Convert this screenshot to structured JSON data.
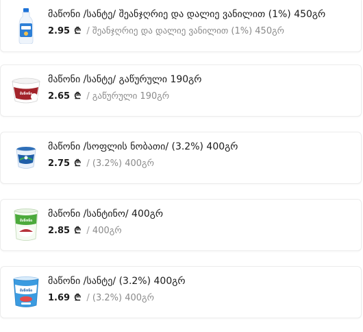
{
  "products": [
    {
      "title": "მაწონი /სანტე/ შეანჯღრიე და დალიე ვანილით (1%) 450გრ",
      "price": "2.95",
      "currency": "₾",
      "separator": "/",
      "subtitle": "შეანჯღრიე და დალიე ვანილით (1%) 450გრ",
      "icon": "drink-bottle-icon"
    },
    {
      "title": "მაწონი /სანტე/ გაწურული 190გრ",
      "price": "2.65",
      "currency": "₾",
      "separator": "/",
      "subtitle": "გაწურული 190გრ",
      "icon": "yogurt-cup-icon",
      "label_text": "მაწონი"
    },
    {
      "title": "მაწონი /სოფლის ნობათი/ (3.2%) 400გრ",
      "price": "2.75",
      "currency": "₾",
      "separator": "/",
      "subtitle": "(3.2%) 400გრ",
      "icon": "yogurt-tub-icon"
    },
    {
      "title": "მაწონი /სანტინო/ 400გრ",
      "price": "2.85",
      "currency": "₾",
      "separator": "/",
      "subtitle": "400გრ",
      "icon": "yogurt-tall-cup-icon",
      "label_text": "მაწონი"
    },
    {
      "title": "მაწონი /სანტე/ (3.2%) 400გრ",
      "price": "1.69",
      "currency": "₾",
      "separator": "/",
      "subtitle": "(3.2%) 400გრ",
      "icon": "yogurt-blue-cup-icon",
      "label_text": "მაწონი"
    }
  ],
  "colors": {
    "border": "#ececec",
    "title": "#1a1a1a",
    "subtitle": "#8a8a8a",
    "brand_blue": "#1565c0",
    "brand_green": "#2e9e3a"
  }
}
